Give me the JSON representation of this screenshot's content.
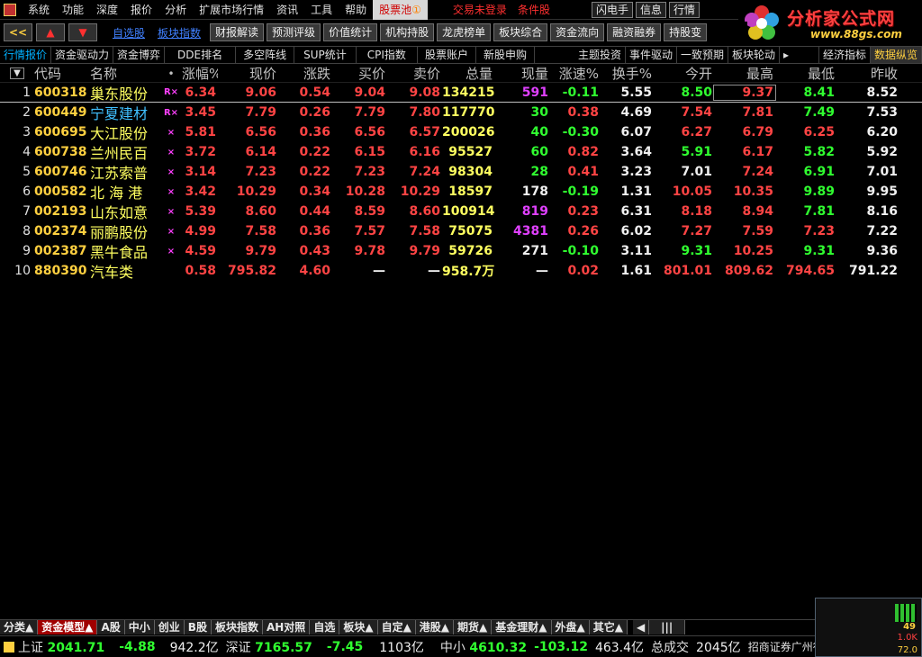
{
  "menu": {
    "items": [
      "系统",
      "功能",
      "深度",
      "报价",
      "分析",
      "扩展市场行情",
      "资讯",
      "工具",
      "帮助"
    ],
    "active": "股票池",
    "active_badge": "①",
    "trade_status": "交易未登录",
    "condition": "条件股",
    "right_buttons": [
      "闪电手",
      "信息",
      "行情"
    ]
  },
  "logo": {
    "title": "分析家公式网",
    "url": "www.88gs.com"
  },
  "toolbar": {
    "nav_buttons": [
      "<<",
      "▲",
      "▼"
    ],
    "links": [
      "自选股",
      "板块指数"
    ],
    "buttons": [
      "财报解读",
      "预测评级",
      "价值统计",
      "机构持股",
      "龙虎榜单",
      "板块综合",
      "资金流向",
      "融资融券",
      "持股变"
    ]
  },
  "subtabs": [
    "行情报价",
    "资金驱动力",
    "资金博弈",
    "DDE排名",
    "多空阵线",
    "SUP统计",
    "CPI指数",
    "股票账户",
    "新股申购",
    "主题投资",
    "事件驱动",
    "一致预期",
    "板块轮动",
    "shortcut-unlabeled",
    "经济指标",
    "数据纵览"
  ],
  "subtabs_text": {
    "shortcut": "\u0000"
  },
  "columns": [
    "代码",
    "名称",
    "•",
    "涨幅%",
    "现价",
    "涨跌",
    "买价",
    "卖价",
    "总量",
    "现量",
    "涨速%",
    "换手%",
    "今开",
    "最高",
    "最低",
    "昨收"
  ],
  "rows": [
    {
      "idx": "1",
      "code": "600318",
      "name": "巢东股份",
      "flag": "R×",
      "chg_pct": "6.34",
      "price": "9.06",
      "chg": "0.54",
      "bid": "9.04",
      "ask": "9.08",
      "vol": "134215",
      "cur": "591",
      "speed": "-0.11",
      "turn": "5.55",
      "open": "8.50",
      "high": "9.37",
      "low": "8.41",
      "prev": "8.52"
    },
    {
      "idx": "2",
      "code": "600449",
      "name": "宁夏建材",
      "flag": "R×",
      "chg_pct": "3.45",
      "price": "7.79",
      "chg": "0.26",
      "bid": "7.79",
      "ask": "7.80",
      "vol": "117770",
      "cur": "30",
      "speed": "0.38",
      "turn": "4.69",
      "open": "7.54",
      "high": "7.81",
      "low": "7.49",
      "prev": "7.53"
    },
    {
      "idx": "3",
      "code": "600695",
      "name": "大江股份",
      "flag": "×",
      "chg_pct": "5.81",
      "price": "6.56",
      "chg": "0.36",
      "bid": "6.56",
      "ask": "6.57",
      "vol": "200026",
      "cur": "40",
      "speed": "-0.30",
      "turn": "6.07",
      "open": "6.27",
      "high": "6.79",
      "low": "6.25",
      "prev": "6.20"
    },
    {
      "idx": "4",
      "code": "600738",
      "name": "兰州民百",
      "flag": "×",
      "chg_pct": "3.72",
      "price": "6.14",
      "chg": "0.22",
      "bid": "6.15",
      "ask": "6.16",
      "vol": "95527",
      "cur": "60",
      "speed": "0.82",
      "turn": "3.64",
      "open": "5.91",
      "high": "6.17",
      "low": "5.82",
      "prev": "5.92"
    },
    {
      "idx": "5",
      "code": "600746",
      "name": "江苏索普",
      "flag": "×",
      "chg_pct": "3.14",
      "price": "7.23",
      "chg": "0.22",
      "bid": "7.23",
      "ask": "7.24",
      "vol": "98304",
      "cur": "28",
      "speed": "0.41",
      "turn": "3.23",
      "open": "7.01",
      "high": "7.24",
      "low": "6.91",
      "prev": "7.01"
    },
    {
      "idx": "6",
      "code": "000582",
      "name": "北 海 港",
      "flag": "×",
      "chg_pct": "3.42",
      "price": "10.29",
      "chg": "0.34",
      "bid": "10.28",
      "ask": "10.29",
      "vol": "18597",
      "cur": "178",
      "speed": "-0.19",
      "turn": "1.31",
      "open": "10.05",
      "high": "10.35",
      "low": "9.89",
      "prev": "9.95"
    },
    {
      "idx": "7",
      "code": "002193",
      "name": "山东如意",
      "flag": "×",
      "chg_pct": "5.39",
      "price": "8.60",
      "chg": "0.44",
      "bid": "8.59",
      "ask": "8.60",
      "vol": "100914",
      "cur": "819",
      "speed": "0.23",
      "turn": "6.31",
      "open": "8.18",
      "high": "8.94",
      "low": "7.81",
      "prev": "8.16"
    },
    {
      "idx": "8",
      "code": "002374",
      "name": "丽鹏股份",
      "flag": "×",
      "chg_pct": "4.99",
      "price": "7.58",
      "chg": "0.36",
      "bid": "7.57",
      "ask": "7.58",
      "vol": "75075",
      "cur": "4381",
      "speed": "0.26",
      "turn": "6.02",
      "open": "7.27",
      "high": "7.59",
      "low": "7.23",
      "prev": "7.22"
    },
    {
      "idx": "9",
      "code": "002387",
      "name": "黑牛食品",
      "flag": "×",
      "chg_pct": "4.59",
      "price": "9.79",
      "chg": "0.43",
      "bid": "9.78",
      "ask": "9.79",
      "vol": "59726",
      "cur": "271",
      "speed": "-0.10",
      "turn": "3.11",
      "open": "9.31",
      "high": "10.25",
      "low": "9.31",
      "prev": "9.36"
    },
    {
      "idx": "10",
      "code": "880390",
      "name": "汽车类",
      "flag": "",
      "chg_pct": "0.58",
      "price": "795.82",
      "chg": "4.60",
      "bid": "—",
      "ask": "—",
      "vol": "958.7万",
      "cur": "—",
      "speed": "0.02",
      "turn": "1.61",
      "open": "801.01",
      "high": "809.62",
      "low": "794.65",
      "prev": "791.22"
    }
  ],
  "bottom_tabs": [
    "分类▲",
    "资金模型▲",
    "A股",
    "中小",
    "创业",
    "B股",
    "板块指数",
    "AH对照",
    "自选",
    "板块▲",
    "自定▲",
    "港股▲",
    "期货▲",
    "基金理财▲",
    "外盘▲",
    "其它▲"
  ],
  "status": {
    "sh_label": "上证",
    "sh_value": "2041.71",
    "sh_chg": "-4.88",
    "sh_amt": "942.2亿",
    "sz_label": "深证",
    "sz_value": "7165.57",
    "sz_chg": "-7.45",
    "sz_amt": "1103亿",
    "zx_label": "中小",
    "zx_value": "4610.32",
    "zx_chg": "-103.12",
    "zx_amt": "463.4亿",
    "total_label": "总成交",
    "total_amt": "2045亿",
    "broker": "招商证券广州行情"
  },
  "widget": {
    "value": "49",
    "kb": "1.0K",
    "speed": "72.0"
  },
  "colors": {
    "up": "#ff4444",
    "down": "#30ff30",
    "flat": "#f0f0f0",
    "code": "#ffd040",
    "name": "#ffff60",
    "bg": "#000000"
  }
}
